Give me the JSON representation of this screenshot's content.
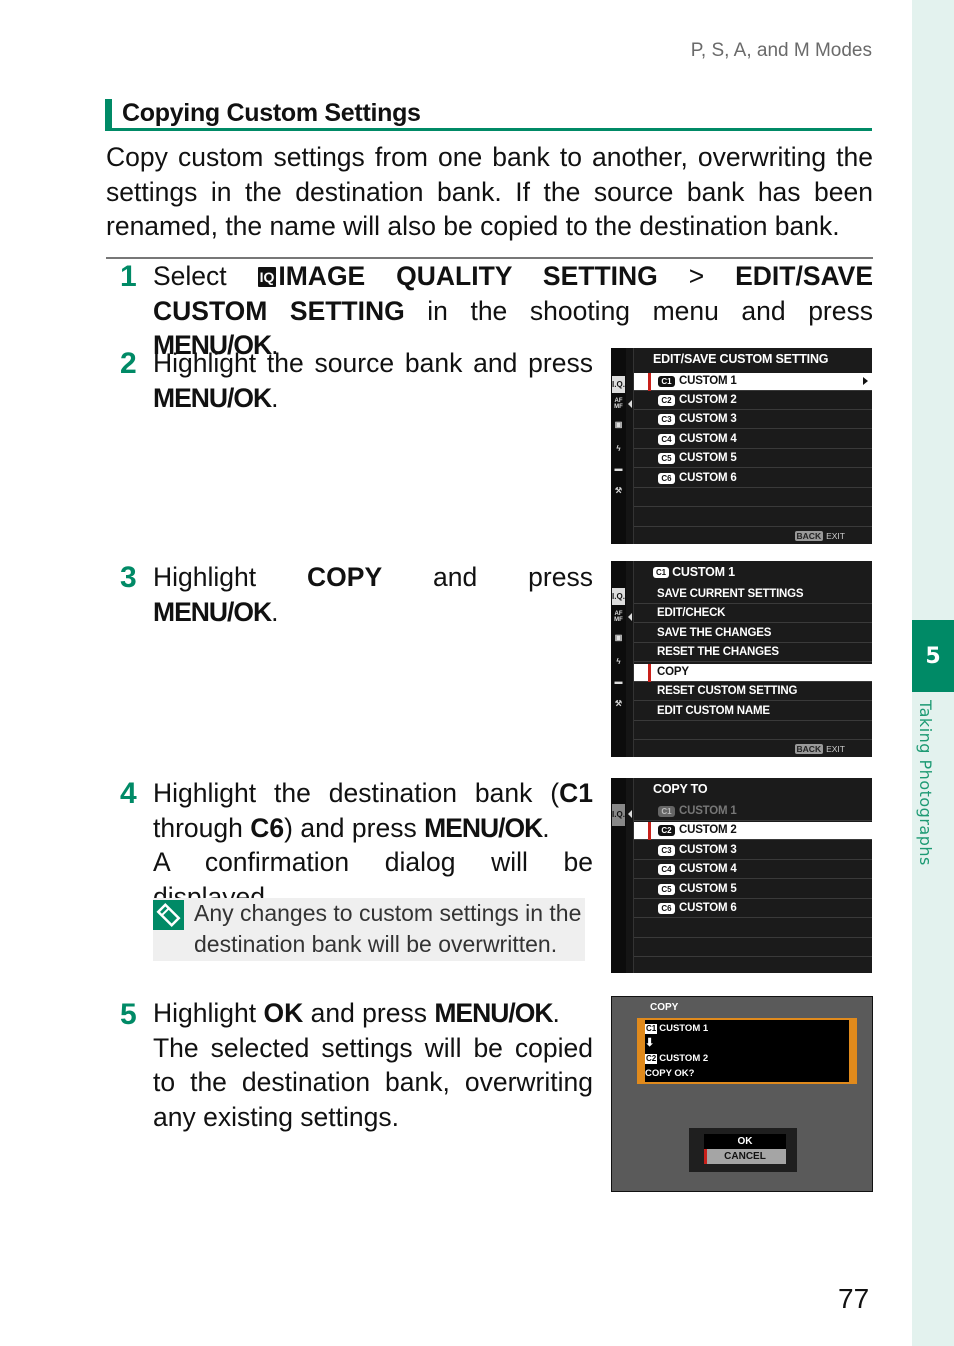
{
  "running_head": "P, S, A, and M Modes",
  "section_title": "Copying Custom Settings",
  "intro": "Copy custom settings from one bank to another, overwriting the settings in the destination bank. If the source bank has been renamed, the name will also be copied to the destination bank.",
  "steps": [
    {
      "number": "1",
      "parts": [
        "Select ",
        "IQ",
        "IMAGE QUALITY SETTING",
        " > ",
        "EDIT/SAVE CUSTOM SETTING",
        " in the shooting menu and press ",
        "MENU/OK",
        "."
      ]
    },
    {
      "number": "2",
      "parts": [
        "Highlight the source bank and press ",
        "MENU/OK",
        "."
      ]
    },
    {
      "number": "3",
      "parts": [
        "Highlight ",
        "COPY",
        " and press ",
        "MENU/OK",
        "."
      ]
    },
    {
      "number": "4",
      "parts": [
        "Highlight the destination bank (",
        "C1",
        " through ",
        "C6",
        ") and press ",
        "MENU/OK",
        ".",
        "A confirmation dialog will be displayed."
      ]
    },
    {
      "number": "5",
      "parts": [
        "Highlight ",
        "OK",
        " and press ",
        "MENU/OK",
        ".",
        "The selected settings will be copied to the destination bank, overwriting any existing settings."
      ]
    }
  ],
  "note": "Any changes to custom settings in the destination bank will be overwritten.",
  "chapter": {
    "number": "5",
    "label": "Taking Photographs"
  },
  "page_number": "77",
  "tab_icons": [
    "I.Q.",
    "AF MF",
    "camera-icon",
    "flash-icon",
    "movie-icon",
    "wrench-icon"
  ],
  "screens": {
    "edit_save": {
      "title": "EDIT/SAVE CUSTOM SETTING",
      "items": [
        {
          "badge": "C1",
          "label": "CUSTOM 1",
          "selected": true
        },
        {
          "badge": "C2",
          "label": "CUSTOM 2"
        },
        {
          "badge": "C3",
          "label": "CUSTOM 3"
        },
        {
          "badge": "C4",
          "label": "CUSTOM 4"
        },
        {
          "badge": "C5",
          "label": "CUSTOM 5"
        },
        {
          "badge": "C6",
          "label": "CUSTOM 6"
        }
      ],
      "back_label": "BACK",
      "exit_label": "EXIT"
    },
    "custom1": {
      "title_badge": "C1",
      "title": "CUSTOM 1",
      "items": [
        "SAVE CURRENT SETTINGS",
        "EDIT/CHECK",
        "SAVE THE CHANGES",
        "RESET THE CHANGES",
        "COPY",
        "RESET CUSTOM SETTING",
        "EDIT CUSTOM NAME"
      ],
      "selected_index": 4,
      "back_label": "BACK",
      "exit_label": "EXIT"
    },
    "copy_to": {
      "title": "COPY TO",
      "items": [
        {
          "badge": "C1",
          "label": "CUSTOM 1",
          "disabled": true
        },
        {
          "badge": "C2",
          "label": "CUSTOM 2",
          "selected": true
        },
        {
          "badge": "C3",
          "label": "CUSTOM 3"
        },
        {
          "badge": "C4",
          "label": "CUSTOM 4"
        },
        {
          "badge": "C5",
          "label": "CUSTOM 5"
        },
        {
          "badge": "C6",
          "label": "CUSTOM 6"
        }
      ]
    },
    "confirm": {
      "title": "COPY",
      "source_badge": "C1",
      "source": "CUSTOM 1",
      "arrow": "🡇",
      "dest_badge": "C2",
      "dest": "CUSTOM 2",
      "question": "COPY OK?",
      "ok_label": "OK",
      "cancel_label": "CANCEL"
    }
  }
}
